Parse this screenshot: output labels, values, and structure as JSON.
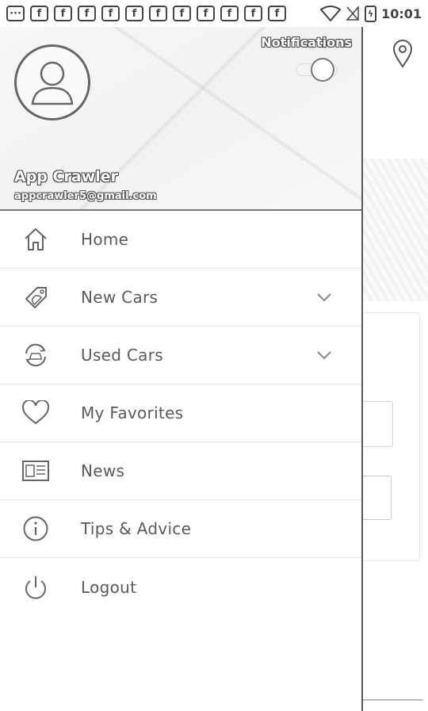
{
  "status_bar": {
    "icons": [
      "more-icon",
      "facebook-icon",
      "facebook-icon",
      "facebook-icon",
      "facebook-icon",
      "facebook-icon",
      "facebook-icon",
      "facebook-icon",
      "facebook-icon",
      "facebook-icon",
      "facebook-icon",
      "facebook-icon"
    ],
    "overflow_glyph": "···",
    "notification_glyph": "f",
    "battery_glyph": "ϟ",
    "time": "10:01"
  },
  "drawer": {
    "header": {
      "notifications_label": "Notifications",
      "notifications_enabled": false,
      "user_name": "App Crawler",
      "user_email": "appcrawler5@gmail.com"
    },
    "menu": [
      {
        "label": "Home",
        "icon": "home-icon",
        "expandable": false
      },
      {
        "label": "New Cars",
        "icon": "car-tag-icon",
        "expandable": true
      },
      {
        "label": "Used Cars",
        "icon": "car-cycle-icon",
        "expandable": true
      },
      {
        "label": "My Favorites",
        "icon": "heart-icon",
        "expandable": false
      },
      {
        "label": "News",
        "icon": "newspaper-icon",
        "expandable": false
      },
      {
        "label": "Tips & Advice",
        "icon": "info-icon",
        "expandable": false
      },
      {
        "label": "Logout",
        "icon": "power-icon",
        "expandable": false
      }
    ]
  }
}
